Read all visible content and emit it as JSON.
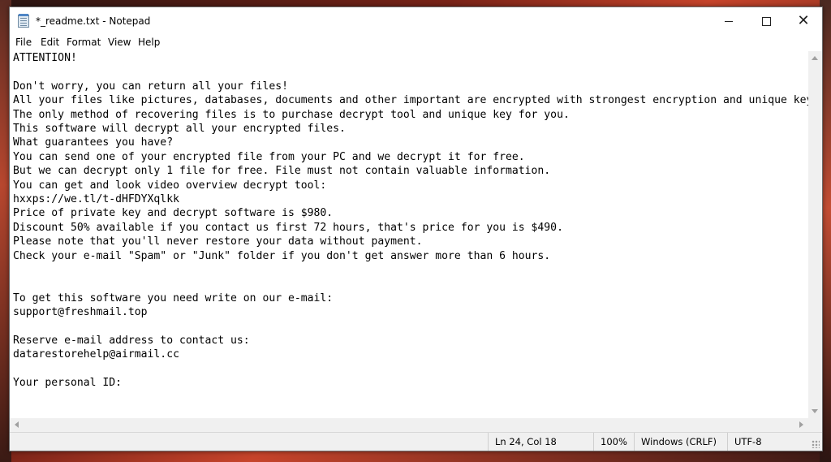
{
  "window": {
    "title": "*_readme.txt - Notepad"
  },
  "icons": {
    "app": "notepad-icon",
    "minimize": "minimize-icon",
    "maximize": "maximize-icon",
    "close": "close-icon",
    "scroll_up": "scroll-up-arrow-icon",
    "scroll_down": "scroll-down-arrow-icon",
    "scroll_left": "scroll-left-arrow-icon",
    "scroll_right": "scroll-right-arrow-icon",
    "grip": "resize-grip-icon"
  },
  "menu": {
    "items": [
      "File",
      "Edit",
      "Format",
      "View",
      "Help"
    ]
  },
  "document": {
    "lines": [
      "ATTENTION!",
      "",
      "Don't worry, you can return all your files!",
      "All your files like pictures, databases, documents and other important are encrypted with strongest encryption and unique key.",
      "The only method of recovering files is to purchase decrypt tool and unique key for you.",
      "This software will decrypt all your encrypted files.",
      "What guarantees you have?",
      "You can send one of your encrypted file from your PC and we decrypt it for free.",
      "But we can decrypt only 1 file for free. File must not contain valuable information.",
      "You can get and look video overview decrypt tool:",
      "hxxps://we.tl/t-dHFDYXqlkk",
      "Price of private key and decrypt software is $980.",
      "Discount 50% available if you contact us first 72 hours, that's price for you is $490.",
      "Please note that you'll never restore your data without payment.",
      "Check your e-mail \"Spam\" or \"Junk\" folder if you don't get answer more than 6 hours.",
      "",
      "",
      "To get this software you need write on our e-mail:",
      "support@freshmail.top",
      "",
      "Reserve e-mail address to contact us:",
      "datarestorehelp@airmail.cc",
      "",
      "Your personal ID:"
    ]
  },
  "status": {
    "position": "Ln 24, Col 18",
    "zoom": "100%",
    "line_ending": "Windows (CRLF)",
    "encoding": "UTF-8"
  }
}
